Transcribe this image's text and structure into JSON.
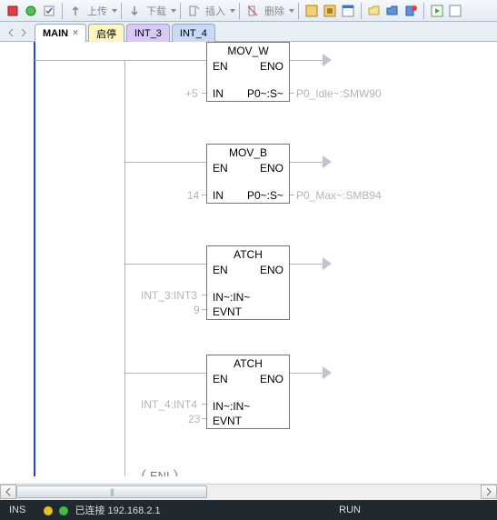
{
  "toolbar": {
    "upload_label": "上传",
    "download_label": "下载",
    "insert_label": "插入",
    "delete_label": "删除"
  },
  "tabs": {
    "main": "MAIN",
    "startstop": "启停",
    "int3": "INT_3",
    "int4": "INT_4"
  },
  "blocks": {
    "b1": {
      "title": "MOV_W",
      "en": "EN",
      "eno": "ENO",
      "in": "IN",
      "out": "P0~:S~",
      "in_val": "+5",
      "out_label": "P0_Idle~:SMW90"
    },
    "b2": {
      "title": "MOV_B",
      "en": "EN",
      "eno": "ENO",
      "in": "IN",
      "out": "P0~:S~",
      "in_val": "14",
      "out_label": "P0_Max~:SMB94"
    },
    "b3": {
      "title": "ATCH",
      "en": "EN",
      "eno": "ENO",
      "in": "IN~:IN~",
      "evnt": "EVNT",
      "in_label": "INT_3:INT3",
      "evnt_val": "9"
    },
    "b4": {
      "title": "ATCH",
      "en": "EN",
      "eno": "ENO",
      "in": "IN~:IN~",
      "evnt": "EVNT",
      "in_label": "INT_4:INT4",
      "evnt_val": "23"
    }
  },
  "eni": "ENI",
  "status": {
    "ins": "INS",
    "conn": "已连接 192.168.2.1",
    "run": "RUN"
  }
}
